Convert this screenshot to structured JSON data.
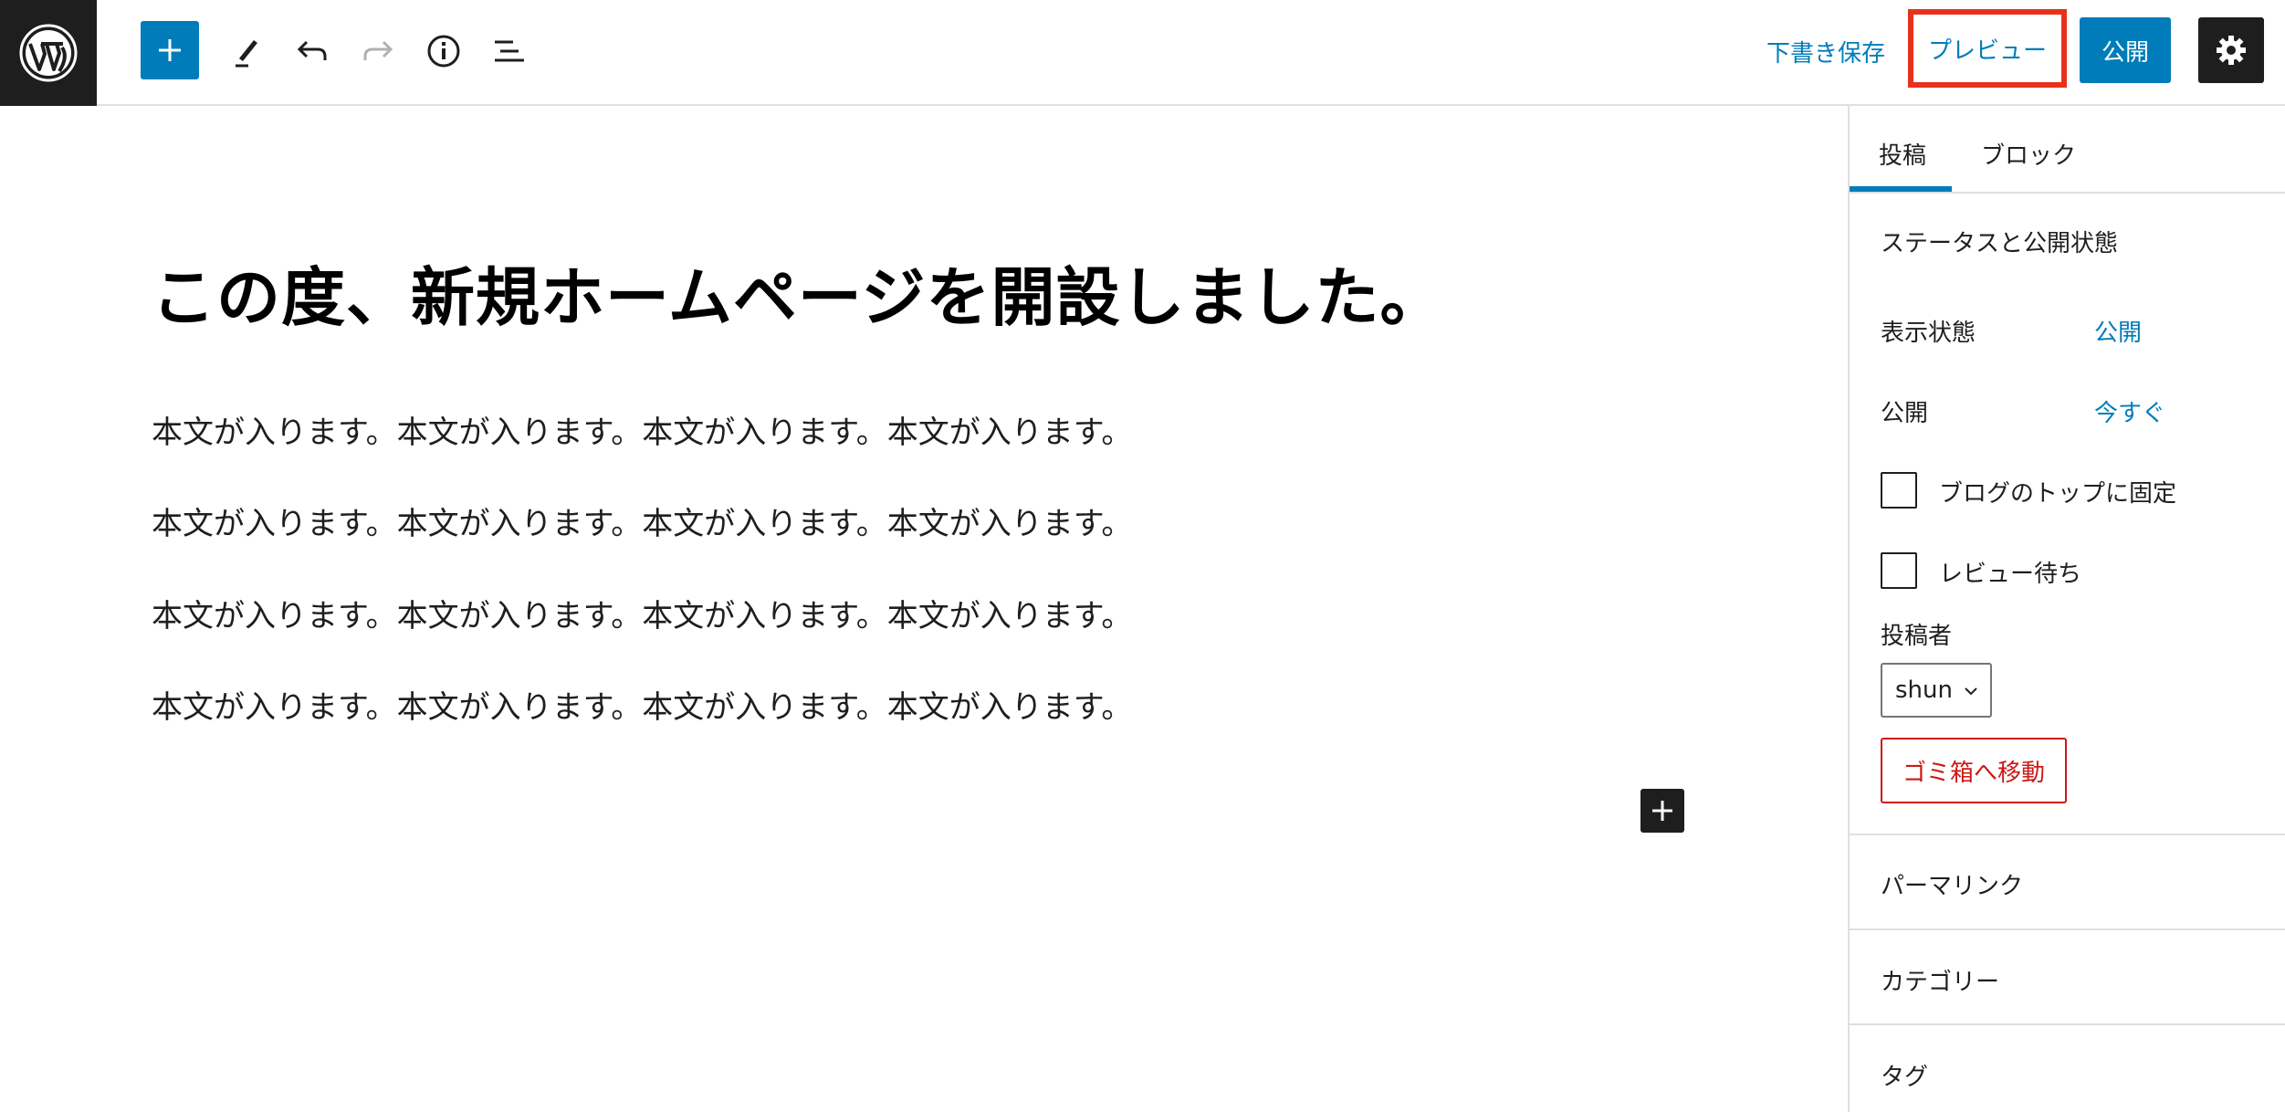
{
  "toolbar": {
    "save_draft_label": "下書き保存",
    "preview_label": "プレビュー",
    "publish_label": "公開"
  },
  "editor": {
    "title": "この度、新規ホームページを開設しました。",
    "paragraphs": [
      "本文が入ります。本文が入ります。本文が入ります。本文が入ります。",
      "本文が入ります。本文が入ります。本文が入ります。本文が入ります。",
      "本文が入ります。本文が入ります。本文が入ります。本文が入ります。",
      "本文が入ります。本文が入ります。本文が入ります。本文が入ります。"
    ]
  },
  "sidebar": {
    "tabs": [
      {
        "label": "投稿",
        "active": true
      },
      {
        "label": "ブロック",
        "active": false
      }
    ],
    "status_section": {
      "title": "ステータスと公開状態",
      "visibility_label": "表示状態",
      "visibility_value": "公開",
      "publish_label": "公開",
      "publish_value": "今すぐ",
      "sticky_label": "ブログのトップに固定",
      "pending_label": "レビュー待ち",
      "author_label": "投稿者",
      "author_value": "shun",
      "trash_label": "ゴミ箱へ移動"
    },
    "panels": [
      "パーマリンク",
      "カテゴリー",
      "タグ"
    ]
  },
  "colors": {
    "accent": "#007cba",
    "dark": "#1e1e1e",
    "danger": "#cc1818",
    "highlight_box": "#e8311c"
  },
  "icons": [
    "wordpress-logo-icon",
    "plus-icon",
    "pencil-icon",
    "undo-icon",
    "redo-icon",
    "info-icon",
    "list-view-icon",
    "gear-icon",
    "chevron-down-icon"
  ]
}
